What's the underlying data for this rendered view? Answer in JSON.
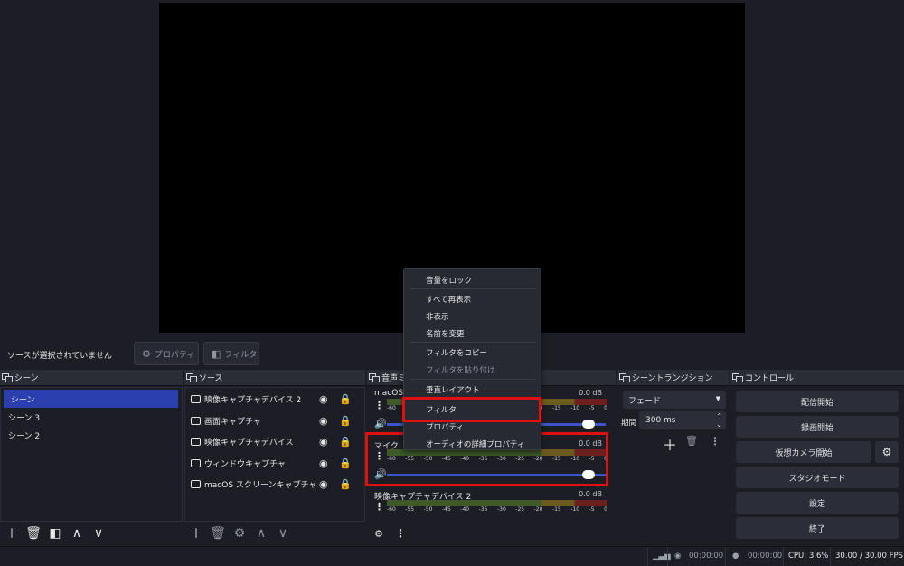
{
  "source_toolbar": {
    "status_text": "ソースが選択されていません",
    "properties_label": "プロパティ",
    "filters_label": "フィルタ"
  },
  "scenes": {
    "title": "シーン",
    "items": [
      {
        "label": "シーン",
        "selected": true
      },
      {
        "label": "シーン 3",
        "selected": false
      },
      {
        "label": "シーン 2",
        "selected": false
      }
    ]
  },
  "sources": {
    "title": "ソース",
    "items": [
      {
        "label": "映像キャプチャデバイス 2",
        "icon": "camera-icon"
      },
      {
        "label": "画面キャプチャ",
        "icon": "monitor-icon"
      },
      {
        "label": "映像キャプチャデバイス",
        "icon": "camera-icon"
      },
      {
        "label": "ウィンドウキャプチャ",
        "icon": "window-icon"
      },
      {
        "label": "macOS スクリーンキャプチャ",
        "icon": "monitor-icon"
      }
    ]
  },
  "mixer": {
    "title": "音声ミ",
    "ticks": [
      "-60",
      "-55",
      "-50",
      "-45",
      "-40",
      "-35",
      "-30",
      "-25",
      "-20",
      "-15",
      "-10",
      "-5",
      "0"
    ],
    "channels": [
      {
        "name": "macOS",
        "db": "0.0 dB"
      },
      {
        "name": "マイク",
        "db": "0.0 dB"
      },
      {
        "name": "映像キャプチャデバイス 2",
        "db": "0.0 dB"
      }
    ]
  },
  "transitions": {
    "title": "シーントランジション",
    "selected": "フェード",
    "duration_label": "期間",
    "duration_value": "300 ms"
  },
  "controls": {
    "title": "コントロール",
    "start_streaming": "配信開始",
    "start_recording": "録画開始",
    "start_virtual_camera": "仮想カメラ開始",
    "studio_mode": "スタジオモード",
    "settings": "設定",
    "exit": "終了"
  },
  "context_menu": {
    "items": [
      {
        "label": "音量をロック",
        "disabled": false
      },
      {
        "label": "すべて再表示",
        "disabled": false
      },
      {
        "label": "非表示",
        "disabled": false
      },
      {
        "label": "名前を変更",
        "disabled": false
      },
      {
        "label": "フィルタをコピー",
        "disabled": false
      },
      {
        "label": "フィルタを貼り付け",
        "disabled": true
      },
      {
        "label": "垂直レイアウト",
        "disabled": false
      },
      {
        "label": "フィルタ",
        "disabled": false
      },
      {
        "label": "プロパティ",
        "disabled": false
      },
      {
        "label": "オーディオの詳細プロパティ",
        "disabled": false
      }
    ]
  },
  "status_bar": {
    "stream_time": "00:00:00",
    "record_time": "00:00:00",
    "cpu": "CPU: 3.6%",
    "fps": "30.00 / 30.00 FPS"
  },
  "colors": {
    "accent": "#2c3fae",
    "highlight_box": "#e01010",
    "background": "#1d1e25"
  }
}
